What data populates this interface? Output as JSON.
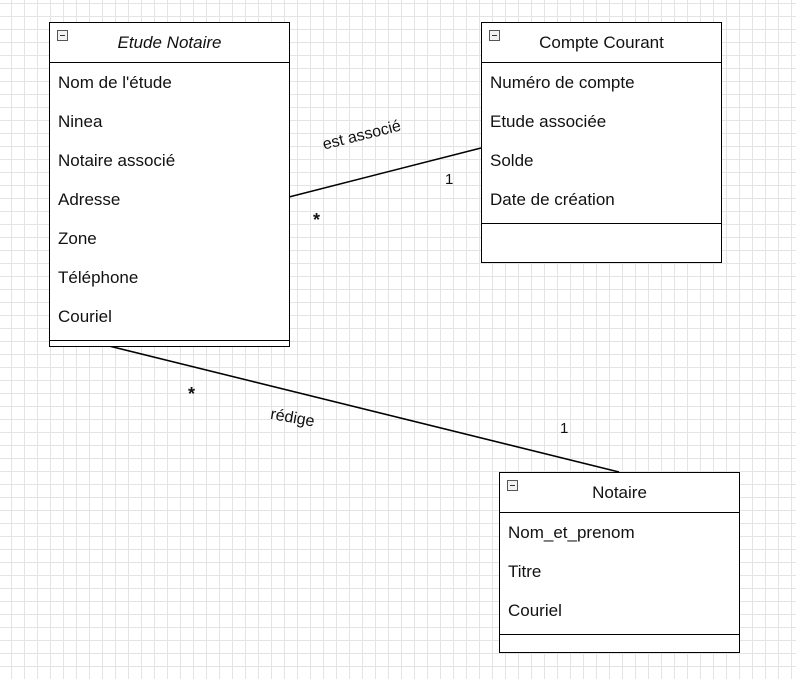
{
  "classes": {
    "etude": {
      "title": "Etude Notaire",
      "attributes": [
        "Nom de l'étude",
        "Ninea",
        "Notaire associé",
        "Adresse",
        "Zone",
        "Téléphone",
        "Couriel"
      ]
    },
    "compte": {
      "title": "Compte Courant",
      "attributes": [
        "Numéro de compte",
        "Etude associée",
        "Solde",
        "Date de création"
      ]
    },
    "notaire": {
      "title": "Notaire",
      "attributes": [
        "Nom_et_prenom",
        "Titre",
        "Couriel"
      ]
    }
  },
  "associations": {
    "etude_compte": {
      "label": "est associé",
      "mult_etude": "*",
      "mult_compte": "1"
    },
    "etude_notaire": {
      "label": "rédige",
      "mult_etude": "*",
      "mult_notaire": "1"
    }
  }
}
